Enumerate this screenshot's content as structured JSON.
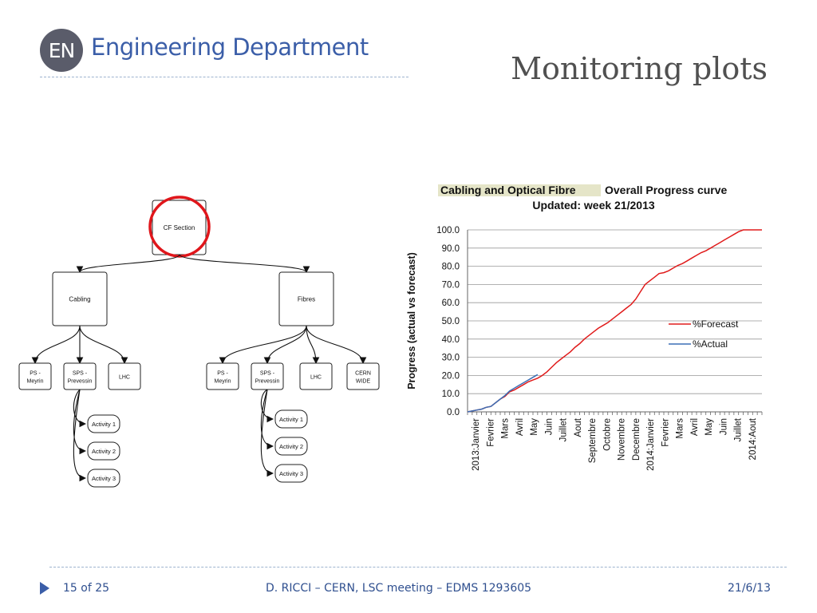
{
  "header": {
    "logo_text": "EN",
    "department": "Engineering Department",
    "title": "Monitoring plots"
  },
  "org_chart": {
    "root": "CF Section",
    "branches": [
      {
        "label": "Cabling",
        "children": [
          "PS - Meyrin",
          "SPS - Prevessin",
          "LHC"
        ],
        "activities": [
          "Activity 1",
          "Activity 2",
          "Activity 3"
        ]
      },
      {
        "label": "Fibres",
        "children": [
          "PS - Meyrin",
          "SPS - Prevessin",
          "LHC",
          "CERN WIDE"
        ],
        "activities": [
          "Activity 1",
          "Activity 2",
          "Activity 3"
        ]
      }
    ],
    "highlight_color": "#e0161b"
  },
  "chart_data": {
    "type": "line",
    "title_highlight": "Cabling and Optical Fibre",
    "title_rest": " Overall Progress curve",
    "subtitle": "Updated: week 21/2013",
    "ylabel": "Progress (actual vs forecast)",
    "ylim": [
      0,
      100
    ],
    "yticks": [
      "0.0",
      "10.0",
      "20.0",
      "30.0",
      "40.0",
      "50.0",
      "60.0",
      "70.0",
      "80.0",
      "90.0",
      "100.0"
    ],
    "x_labels": [
      "2013:Janvier",
      "Fevrier",
      "Mars",
      "Avril",
      "May",
      "Juin",
      "Juillet",
      "Aout",
      "Septembre",
      "Octobre",
      "Novembre",
      "Decembre",
      "2014:Janvier",
      "Fevrier",
      "Mars",
      "Avril",
      "May",
      "Juin",
      "Juillet",
      "2014:Aout"
    ],
    "legend_position": "right",
    "series": [
      {
        "name": "%Forecast",
        "color": "#e01b1b",
        "values": [
          0,
          0.5,
          1,
          1.5,
          2.5,
          3,
          5,
          7,
          8.5,
          11,
          12,
          13.5,
          15,
          16.5,
          17.5,
          18.5,
          20,
          22,
          24.5,
          27,
          29,
          31,
          33,
          35.5,
          37.5,
          40,
          42,
          44,
          46,
          47.5,
          49,
          51,
          53,
          55,
          57,
          59,
          62,
          66,
          70,
          72,
          74,
          76,
          76.5,
          77.5,
          79,
          80.5,
          81.5,
          83,
          84.5,
          86,
          87.5,
          88.5,
          90,
          91.5,
          93,
          94.5,
          96,
          97.5,
          99,
          100,
          100,
          100,
          100,
          100
        ]
      },
      {
        "name": "%Actual",
        "color": "#3b6fb6",
        "values": [
          0,
          0.5,
          1,
          1.5,
          2.5,
          3,
          5,
          7,
          9,
          11.5,
          13,
          14.5,
          16,
          17.5,
          19,
          20.5
        ]
      }
    ]
  },
  "footer": {
    "page": "15 of 25",
    "author": "D. RICCI – CERN, LSC meeting – EDMS 1293605",
    "date": "21/6/13"
  }
}
